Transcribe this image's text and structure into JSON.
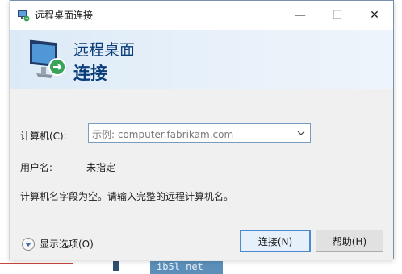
{
  "window": {
    "title": "远程桌面连接",
    "controls": {
      "minimize": "—",
      "maximize": "☐",
      "close": "✕"
    }
  },
  "banner": {
    "line1": "远程桌面",
    "line2": "连接"
  },
  "form": {
    "computer_label": "计算机(C):",
    "computer_placeholder": "示例: computer.fabrikam.com",
    "user_label": "用户名:",
    "user_value": "未指定",
    "message": "计算机名字段为空。请输入完整的远程计算机名。"
  },
  "footer": {
    "show_options": "显示选项(O)",
    "connect": "连接(N)",
    "help": "帮助(H)"
  },
  "background": {
    "bottom_text": "ib5l net"
  },
  "colors": {
    "accent": "#0a3d7a",
    "banner": "#dceaf7",
    "button_focus": "#4a8ad3"
  }
}
